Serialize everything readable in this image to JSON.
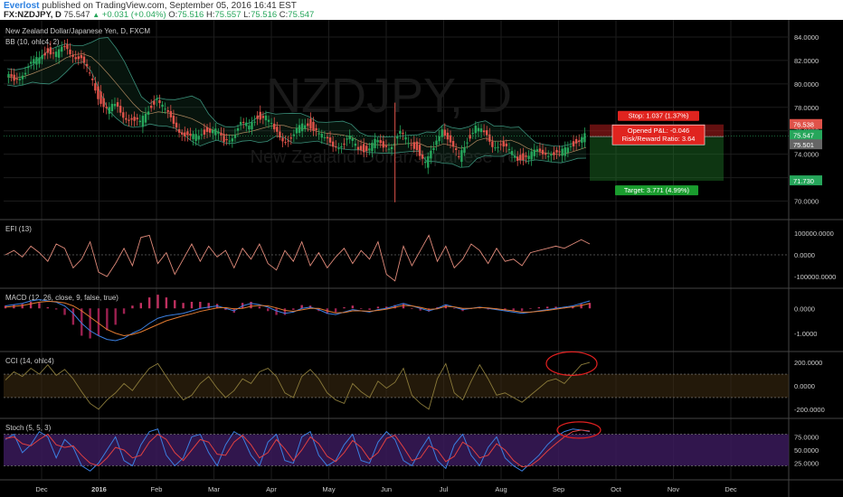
{
  "header": {
    "user": "Everlost",
    "published": "published on TradingView.com, September 05, 2016 16:41 EST",
    "symbol": "FX:NZDJPY, D",
    "last": "75.547",
    "change": "+0.031 (+0.04%)",
    "o_label": "O:",
    "o": "75.516",
    "h_label": "H:",
    "h": "75.557",
    "l_label": "L:",
    "l": "75.516",
    "c_label": "C:",
    "c": "75.547"
  },
  "watermark": {
    "big": "NZDJPY, D",
    "small": "New Zealand Dollar/Japanese Yen"
  },
  "colors": {
    "up": "#26a65b",
    "down": "#e0534a",
    "ma": "#e08a7a",
    "blue": "#3b7fe0",
    "stoch_bg": "#3a1a5a",
    "cci_bg": "#3a2a10"
  },
  "chart_data": [
    {
      "type": "candlestick",
      "title": "New Zealand Dollar/Japanese Yen, D, FXCM",
      "indicator": "BB (10, ohlc4, 2)",
      "x": [
        "Dec",
        "2016",
        "Feb",
        "Mar",
        "Apr",
        "May",
        "Jun",
        "Jul",
        "Aug",
        "Sep",
        "Oct",
        "Nov",
        "Dec"
      ],
      "close": [
        80.6,
        80.4,
        80.9,
        81.6,
        82.3,
        82.9,
        82.5,
        83.1,
        82.6,
        82.0,
        80.8,
        79.0,
        77.8,
        78.1,
        77.4,
        76.9,
        76.6,
        77.9,
        78.8,
        77.6,
        76.8,
        75.8,
        75.3,
        75.7,
        76.1,
        75.9,
        75.1,
        75.6,
        76.5,
        76.4,
        77.3,
        77.1,
        76.0,
        75.4,
        75.2,
        76.3,
        76.7,
        76.0,
        75.2,
        74.9,
        74.7,
        75.3,
        74.6,
        74.4,
        75.0,
        74.7,
        74.8,
        75.7,
        75.0,
        74.6,
        73.1,
        74.5,
        76.4,
        74.8,
        73.7,
        75.3,
        76.3,
        75.7,
        74.9,
        74.8,
        74.2,
        73.7,
        73.8,
        74.1,
        74.2,
        74.1,
        73.9,
        74.7,
        75.1,
        75.5
      ],
      "ylim": [
        68.5,
        85.0
      ],
      "y_ticks": [
        "84.0000",
        "82.0000",
        "80.0000",
        "78.0000",
        "76.0000",
        "74.0000",
        "72.0000",
        "70.0000"
      ],
      "tags": [
        {
          "text": "76.538",
          "color": "#e0534a"
        },
        {
          "text": "75.547",
          "color": "#26a65b"
        },
        {
          "text": "75.501",
          "color": "#666666"
        },
        {
          "text": "71.730",
          "color": "#26a65b"
        }
      ],
      "position_stop": "Stop: 1.037 (1.37%)",
      "position_pnl": "Opened P&L: -0.046",
      "position_rr": "Risk/Reward Ratio: 3.64",
      "position_target": "Target: 3.771 (4.99%)"
    },
    {
      "type": "line",
      "title": "EFI (13)",
      "ylim": [
        -150000,
        150000
      ],
      "y_ticks": [
        "100000.0000",
        "0.0000",
        "-100000.0000"
      ],
      "values": [
        0,
        20000,
        -10000,
        40000,
        10000,
        -30000,
        50000,
        30000,
        -60000,
        -20000,
        60000,
        -80000,
        -100000,
        -40000,
        30000,
        -50000,
        80000,
        90000,
        -40000,
        10000,
        -90000,
        -20000,
        50000,
        -30000,
        40000,
        -10000,
        20000,
        -60000,
        30000,
        -20000,
        50000,
        -40000,
        -70000,
        20000,
        -30000,
        60000,
        -50000,
        10000,
        -60000,
        -10000,
        30000,
        -40000,
        20000,
        -20000,
        60000,
        -90000,
        -120000,
        40000,
        -50000,
        20000,
        90000,
        -30000,
        40000,
        -60000,
        -20000,
        50000,
        20000,
        -40000,
        30000,
        -30000,
        -20000,
        -50000,
        10000,
        20000,
        30000,
        40000,
        30000,
        50000,
        70000,
        50000
      ]
    },
    {
      "type": "line",
      "title": "MACD (12, 26, close, 9, false, true)",
      "ylim": [
        -1.7,
        0.7
      ],
      "y_ticks": [
        "0.0000",
        "-1.0000"
      ],
      "macd": [
        0.1,
        0.15,
        0.2,
        0.3,
        0.35,
        0.3,
        0.25,
        0.1,
        -0.2,
        -0.6,
        -0.9,
        -1.1,
        -1.25,
        -1.3,
        -1.2,
        -1.0,
        -0.85,
        -0.6,
        -0.4,
        -0.3,
        -0.25,
        -0.2,
        -0.1,
        0.0,
        0.05,
        0.1,
        0.0,
        -0.1,
        0.1,
        0.2,
        0.15,
        0.05,
        -0.1,
        -0.2,
        -0.15,
        0.0,
        0.05,
        -0.05,
        -0.2,
        -0.25,
        -0.15,
        -0.05,
        -0.1,
        -0.15,
        -0.05,
        0.0,
        0.1,
        0.2,
        0.1,
        0.0,
        -0.1,
        0.0,
        0.15,
        0.05,
        -0.05,
        0.0,
        0.05,
        0.0,
        -0.05,
        -0.1,
        -0.15,
        -0.2,
        -0.15,
        -0.1,
        -0.05,
        0.0,
        0.05,
        0.1,
        0.2,
        0.3
      ],
      "signal": [
        0.05,
        0.08,
        0.12,
        0.18,
        0.25,
        0.28,
        0.27,
        0.22,
        0.1,
        -0.1,
        -0.35,
        -0.6,
        -0.85,
        -1.0,
        -1.1,
        -1.05,
        -0.95,
        -0.8,
        -0.65,
        -0.5,
        -0.4,
        -0.3,
        -0.22,
        -0.12,
        -0.05,
        0.02,
        0.03,
        -0.02,
        0.0,
        0.08,
        0.12,
        0.1,
        0.02,
        -0.08,
        -0.12,
        -0.06,
        0.0,
        0.0,
        -0.1,
        -0.18,
        -0.17,
        -0.1,
        -0.1,
        -0.12,
        -0.08,
        -0.03,
        0.04,
        0.12,
        0.1,
        0.04,
        -0.04,
        -0.02,
        0.08,
        0.06,
        0.0,
        0.0,
        0.03,
        0.02,
        -0.02,
        -0.06,
        -0.1,
        -0.15,
        -0.15,
        -0.12,
        -0.08,
        -0.03,
        0.02,
        0.06,
        0.12,
        0.2
      ]
    },
    {
      "type": "line",
      "title": "CCI (14, ohlc4)",
      "ylim": [
        -270,
        270
      ],
      "y_ticks": [
        "200.0000",
        "0.0000",
        "-200.0000"
      ],
      "values": [
        50,
        120,
        80,
        150,
        100,
        180,
        90,
        140,
        60,
        -50,
        -150,
        -200,
        -120,
        -60,
        20,
        -40,
        60,
        150,
        190,
        80,
        -30,
        -120,
        -80,
        20,
        80,
        -20,
        -100,
        -40,
        60,
        20,
        120,
        150,
        80,
        -60,
        -100,
        80,
        140,
        60,
        -60,
        -120,
        -150,
        20,
        -50,
        -100,
        40,
        -20,
        30,
        150,
        -80,
        -150,
        -200,
        60,
        190,
        -60,
        -120,
        40,
        180,
        60,
        -80,
        -60,
        -100,
        -140,
        -80,
        -20,
        40,
        60,
        20,
        100,
        180,
        200
      ]
    },
    {
      "type": "line",
      "title": "Stoch (5, 5, 3)",
      "ylim": [
        -5,
        105
      ],
      "y_ticks": [
        "75.0000",
        "50.0000",
        "25.0000"
      ],
      "k": [
        70,
        80,
        45,
        60,
        85,
        75,
        35,
        70,
        55,
        20,
        10,
        25,
        50,
        75,
        30,
        20,
        60,
        85,
        90,
        40,
        20,
        35,
        75,
        80,
        45,
        20,
        60,
        85,
        75,
        40,
        20,
        65,
        80,
        30,
        25,
        75,
        85,
        40,
        20,
        30,
        60,
        80,
        30,
        25,
        65,
        85,
        70,
        30,
        20,
        50,
        75,
        30,
        15,
        60,
        80,
        40,
        20,
        55,
        75,
        35,
        20,
        10,
        25,
        40,
        60,
        75,
        85,
        90,
        88,
        85
      ],
      "d": [
        72,
        75,
        62,
        58,
        70,
        80,
        60,
        55,
        58,
        40,
        25,
        20,
        35,
        55,
        50,
        35,
        40,
        65,
        80,
        70,
        45,
        30,
        50,
        70,
        65,
        42,
        40,
        65,
        78,
        60,
        35,
        45,
        70,
        52,
        30,
        50,
        75,
        62,
        38,
        28,
        45,
        68,
        55,
        32,
        45,
        72,
        78,
        55,
        30,
        35,
        58,
        50,
        28,
        38,
        65,
        55,
        35,
        40,
        62,
        50,
        30,
        18,
        20,
        32,
        48,
        62,
        75,
        85,
        88,
        86
      ]
    }
  ],
  "x_labels": [
    "Dec",
    "2016",
    "Feb",
    "Mar",
    "Apr",
    "May",
    "Jun",
    "Jul",
    "Aug",
    "Sep",
    "Oct",
    "Nov",
    "Dec"
  ]
}
